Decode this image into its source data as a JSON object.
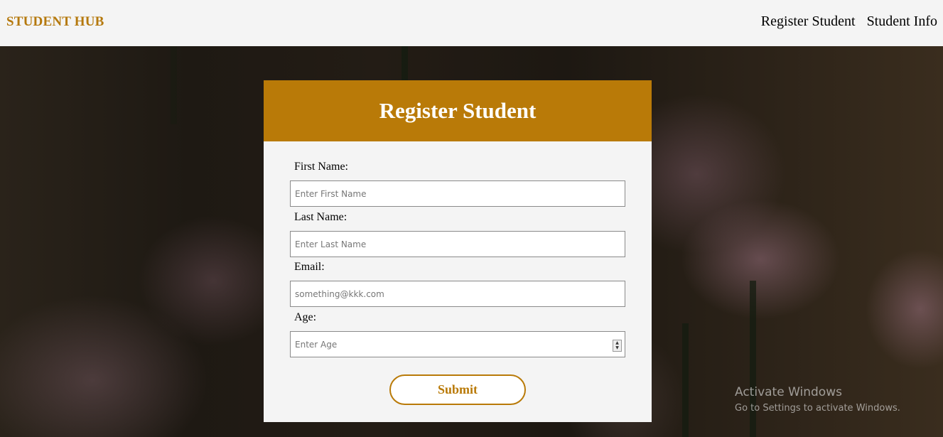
{
  "brand": "STUDENT HUB",
  "nav": {
    "register": "Register Student",
    "info": "Student Info"
  },
  "form": {
    "title": "Register Student",
    "first_name": {
      "label": "First Name:",
      "placeholder": "Enter First Name"
    },
    "last_name": {
      "label": "Last Name:",
      "placeholder": "Enter Last Name"
    },
    "email": {
      "label": "Email:",
      "placeholder": "something@kkk.com"
    },
    "age": {
      "label": "Age:",
      "placeholder": "Enter Age"
    },
    "submit": "Submit"
  },
  "watermark": {
    "title": "Activate Windows",
    "subtitle": "Go to Settings to activate Windows."
  },
  "colors": {
    "accent": "#b97a08",
    "brand_text": "#b5790d",
    "navbar_bg": "#f4f4f4",
    "card_bg": "#f4f4f4"
  },
  "icons": {
    "age_spinner": "spinner-arrows-icon"
  }
}
